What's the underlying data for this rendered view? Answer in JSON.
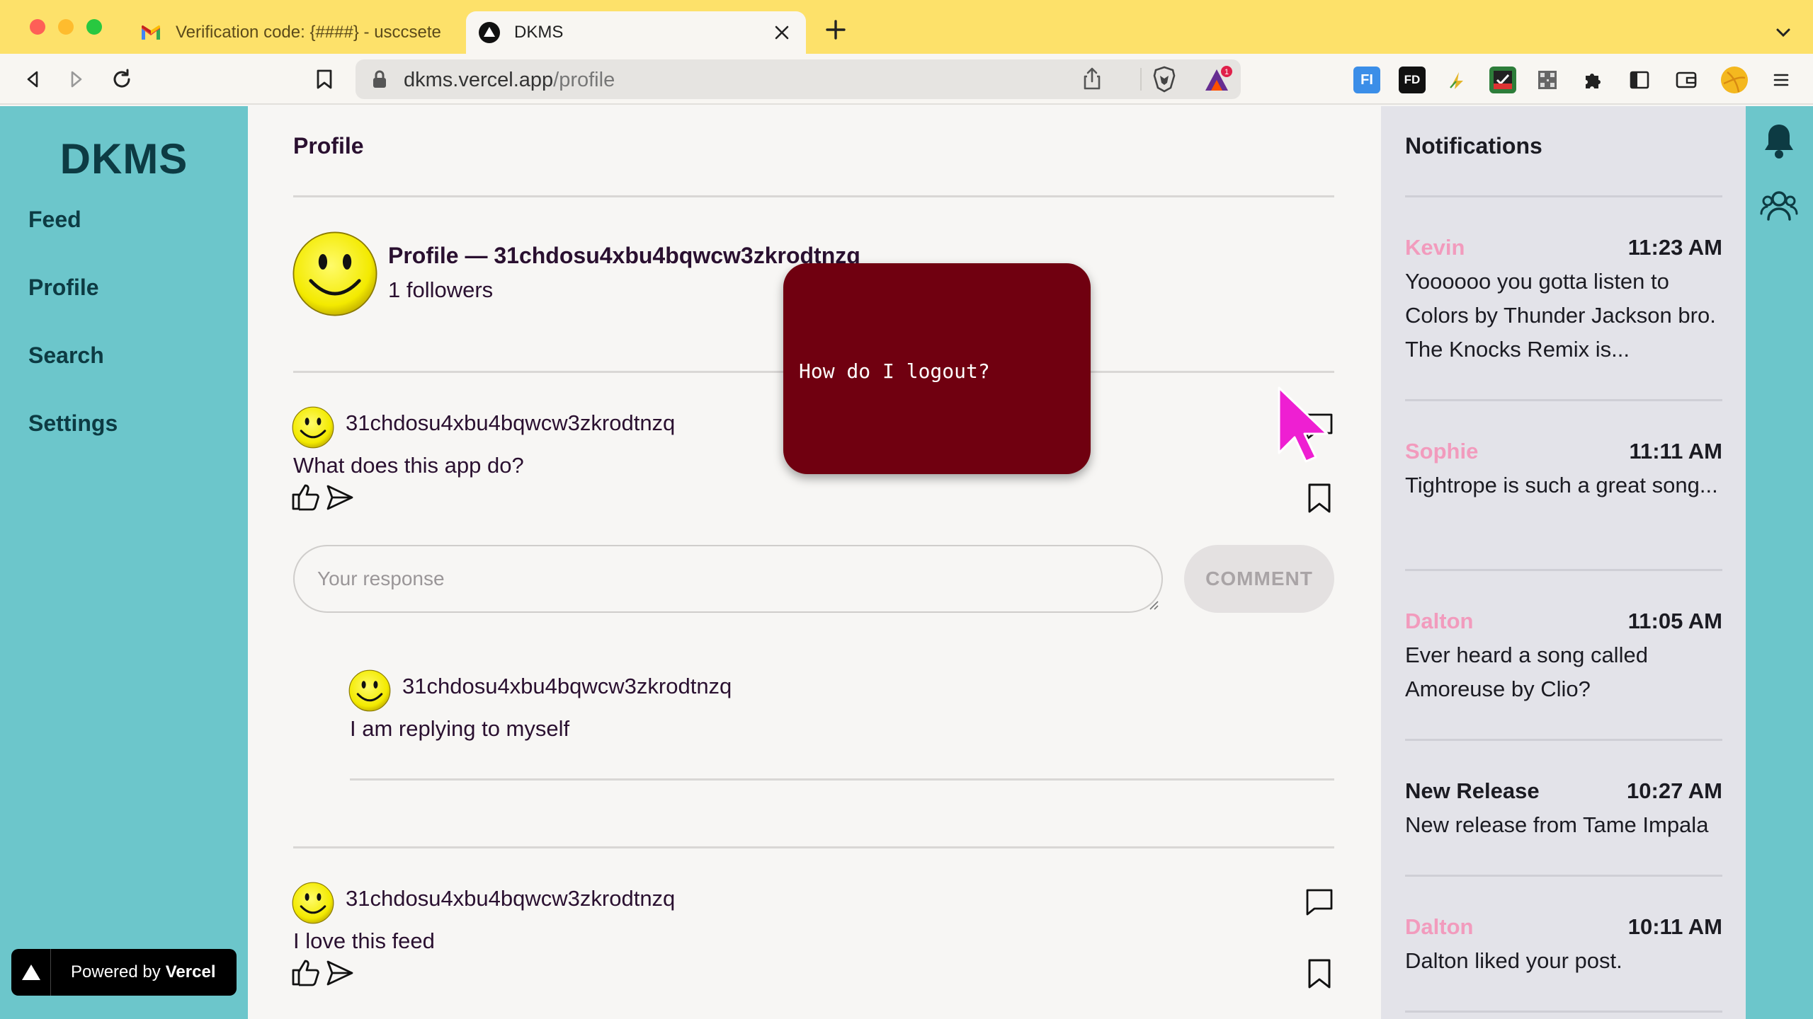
{
  "browser": {
    "tabs": [
      {
        "title": "Verification code: {####} - usccsete",
        "favicon": "gmail-icon",
        "active": false
      },
      {
        "title": "DKMS",
        "favicon": "vercel-triangle-icon",
        "active": true
      }
    ],
    "url_host": "dkms.vercel.app",
    "url_path": "/profile",
    "brave_badge": "1"
  },
  "sidebar": {
    "logo": "DKMS",
    "items": [
      {
        "label": "Feed"
      },
      {
        "label": "Profile"
      },
      {
        "label": "Search"
      },
      {
        "label": "Settings"
      }
    ],
    "vercel_prefix": "Powered by",
    "vercel_brand": "Vercel"
  },
  "main": {
    "title": "Profile",
    "profile_name": "Profile — 31chdosu4xbu4bqwcw3zkrodtnzq",
    "followers": "1 followers",
    "posts": [
      {
        "user": "31chdosu4xbu4bqwcw3zkrodtnzq",
        "text": "What does this app do?",
        "response_placeholder": "Your response",
        "comment_label": "COMMENT",
        "replies": [
          {
            "user": "31chdosu4xbu4bqwcw3zkrodtnzq",
            "text": "I am replying to myself"
          }
        ]
      },
      {
        "user": "31chdosu4xbu4bqwcw3zkrodtnzq",
        "text": "I love this feed"
      }
    ]
  },
  "notifications": {
    "title": "Notifications",
    "items": [
      {
        "name": "Kevin",
        "time": "11:23 AM",
        "text": "Yoooooo you gotta listen to Colors by Thunder Jackson bro. The Knocks Remix is..."
      },
      {
        "name": "Sophie",
        "time": "11:11 AM",
        "text": "Tightrope is such a great song..."
      },
      {
        "name": "Dalton",
        "time": "11:05 AM",
        "text": "Ever heard a song called Amoreuse by Clio?"
      },
      {
        "name": "New Release",
        "time": "10:27 AM",
        "text": "New release from Tame Impala"
      },
      {
        "name": "Dalton",
        "time": "10:11 AM",
        "text": "Dalton liked your post."
      }
    ]
  },
  "popup": {
    "text": "How do I logout?"
  },
  "colors": {
    "teal": "#6cc6cb",
    "navy": "#0d3b43",
    "pink": "#f29bbd",
    "popup": "#700010",
    "cursor": "#ee1fd2"
  }
}
